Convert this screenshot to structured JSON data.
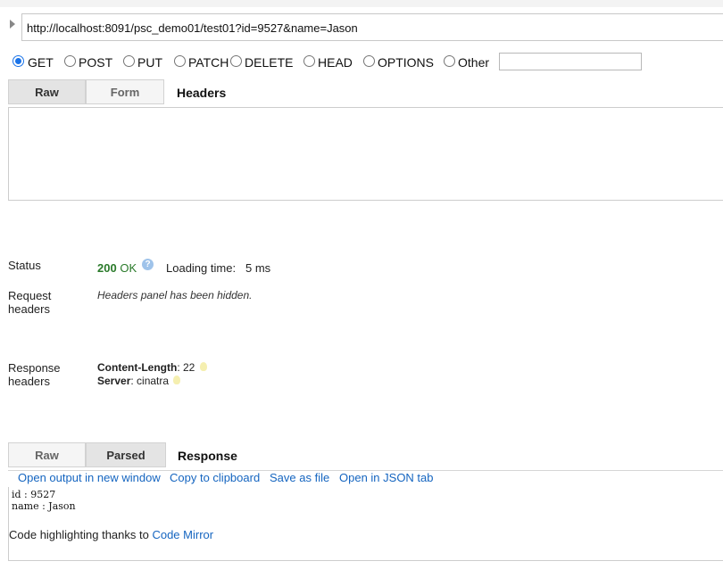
{
  "request": {
    "url": "http://localhost:8091/psc_demo01/test01?id=9527&name=Jason",
    "methods": [
      "GET",
      "POST",
      "PUT",
      "PATCH",
      "DELETE",
      "HEAD",
      "OPTIONS",
      "Other"
    ],
    "selected_method": "GET",
    "other_method_value": "",
    "body_tabs": [
      "Raw",
      "Form"
    ],
    "active_body_tab": "Raw",
    "headers_title": "Headers"
  },
  "status": {
    "label": "Status",
    "code": "200",
    "text": "OK",
    "loading_label": "Loading time:",
    "loading_value": "5 ms"
  },
  "request_headers": {
    "label_line1": "Request",
    "label_line2": "headers",
    "note": "Headers panel has been hidden."
  },
  "response_headers": {
    "label_line1": "Response",
    "label_line2": "headers",
    "items": [
      {
        "name": "Content-Length",
        "value": "22"
      },
      {
        "name": "Server",
        "value": "cinatra"
      }
    ]
  },
  "response": {
    "tabs": [
      "Raw",
      "Parsed"
    ],
    "active_tab": "Parsed",
    "title": "Response",
    "actions": [
      "Open output in new window",
      "Copy to clipboard",
      "Save as file",
      "Open in JSON tab"
    ],
    "output_lines": [
      "id : 9527",
      "name : Jason"
    ],
    "credit_text": "Code highlighting thanks to ",
    "credit_link": "Code Mirror"
  },
  "colors": {
    "accent": "#1a73e8",
    "link": "#1565c0",
    "status_ok": "#2a7a2a"
  }
}
